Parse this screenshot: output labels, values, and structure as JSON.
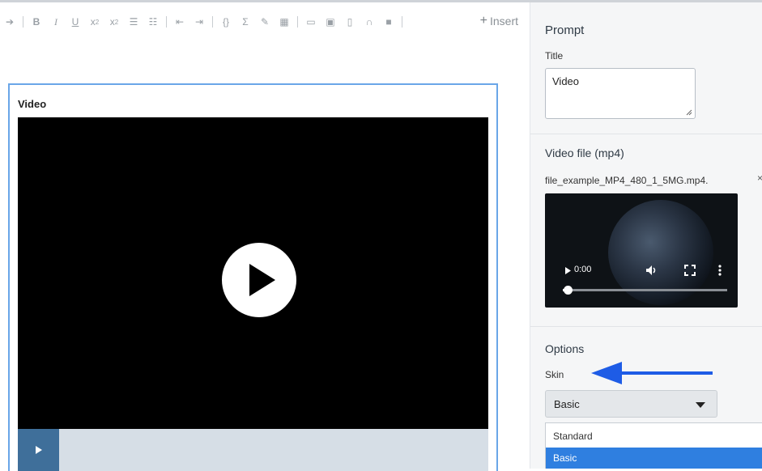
{
  "toolbar": {
    "icons": [
      "redo-icon",
      "bold-icon",
      "italic-icon",
      "underline-icon",
      "subscript-icon",
      "superscript-icon",
      "ordered-list-icon",
      "unordered-list-icon",
      "outdent-icon",
      "indent-icon",
      "code-icon",
      "sigma-icon",
      "link-icon",
      "table-icon",
      "hr-icon",
      "image-icon",
      "file-icon",
      "audio-icon",
      "video-icon"
    ],
    "insert_label": "Insert"
  },
  "video_block": {
    "title": "Video"
  },
  "panel": {
    "prompt_heading": "Prompt",
    "title_label": "Title",
    "title_value": "Video",
    "video_file_heading": "Video file (mp4)",
    "file_name": "file_example_MP4_480_1_5MG.mp4.",
    "remove_symbol": "×",
    "preview_time": "0:00",
    "preview_progress": 0.03,
    "options_heading": "Options",
    "skin_label": "Skin",
    "skin_selected": "Basic",
    "skin_options": [
      {
        "label": "Standard",
        "selected": false
      },
      {
        "label": "Basic",
        "selected": true
      }
    ]
  },
  "colors": {
    "accent_blue": "#2f7fe0",
    "block_border": "#6aa6e8",
    "play_bar": "#3f6f9a",
    "arrow": "#1e5ce6"
  }
}
